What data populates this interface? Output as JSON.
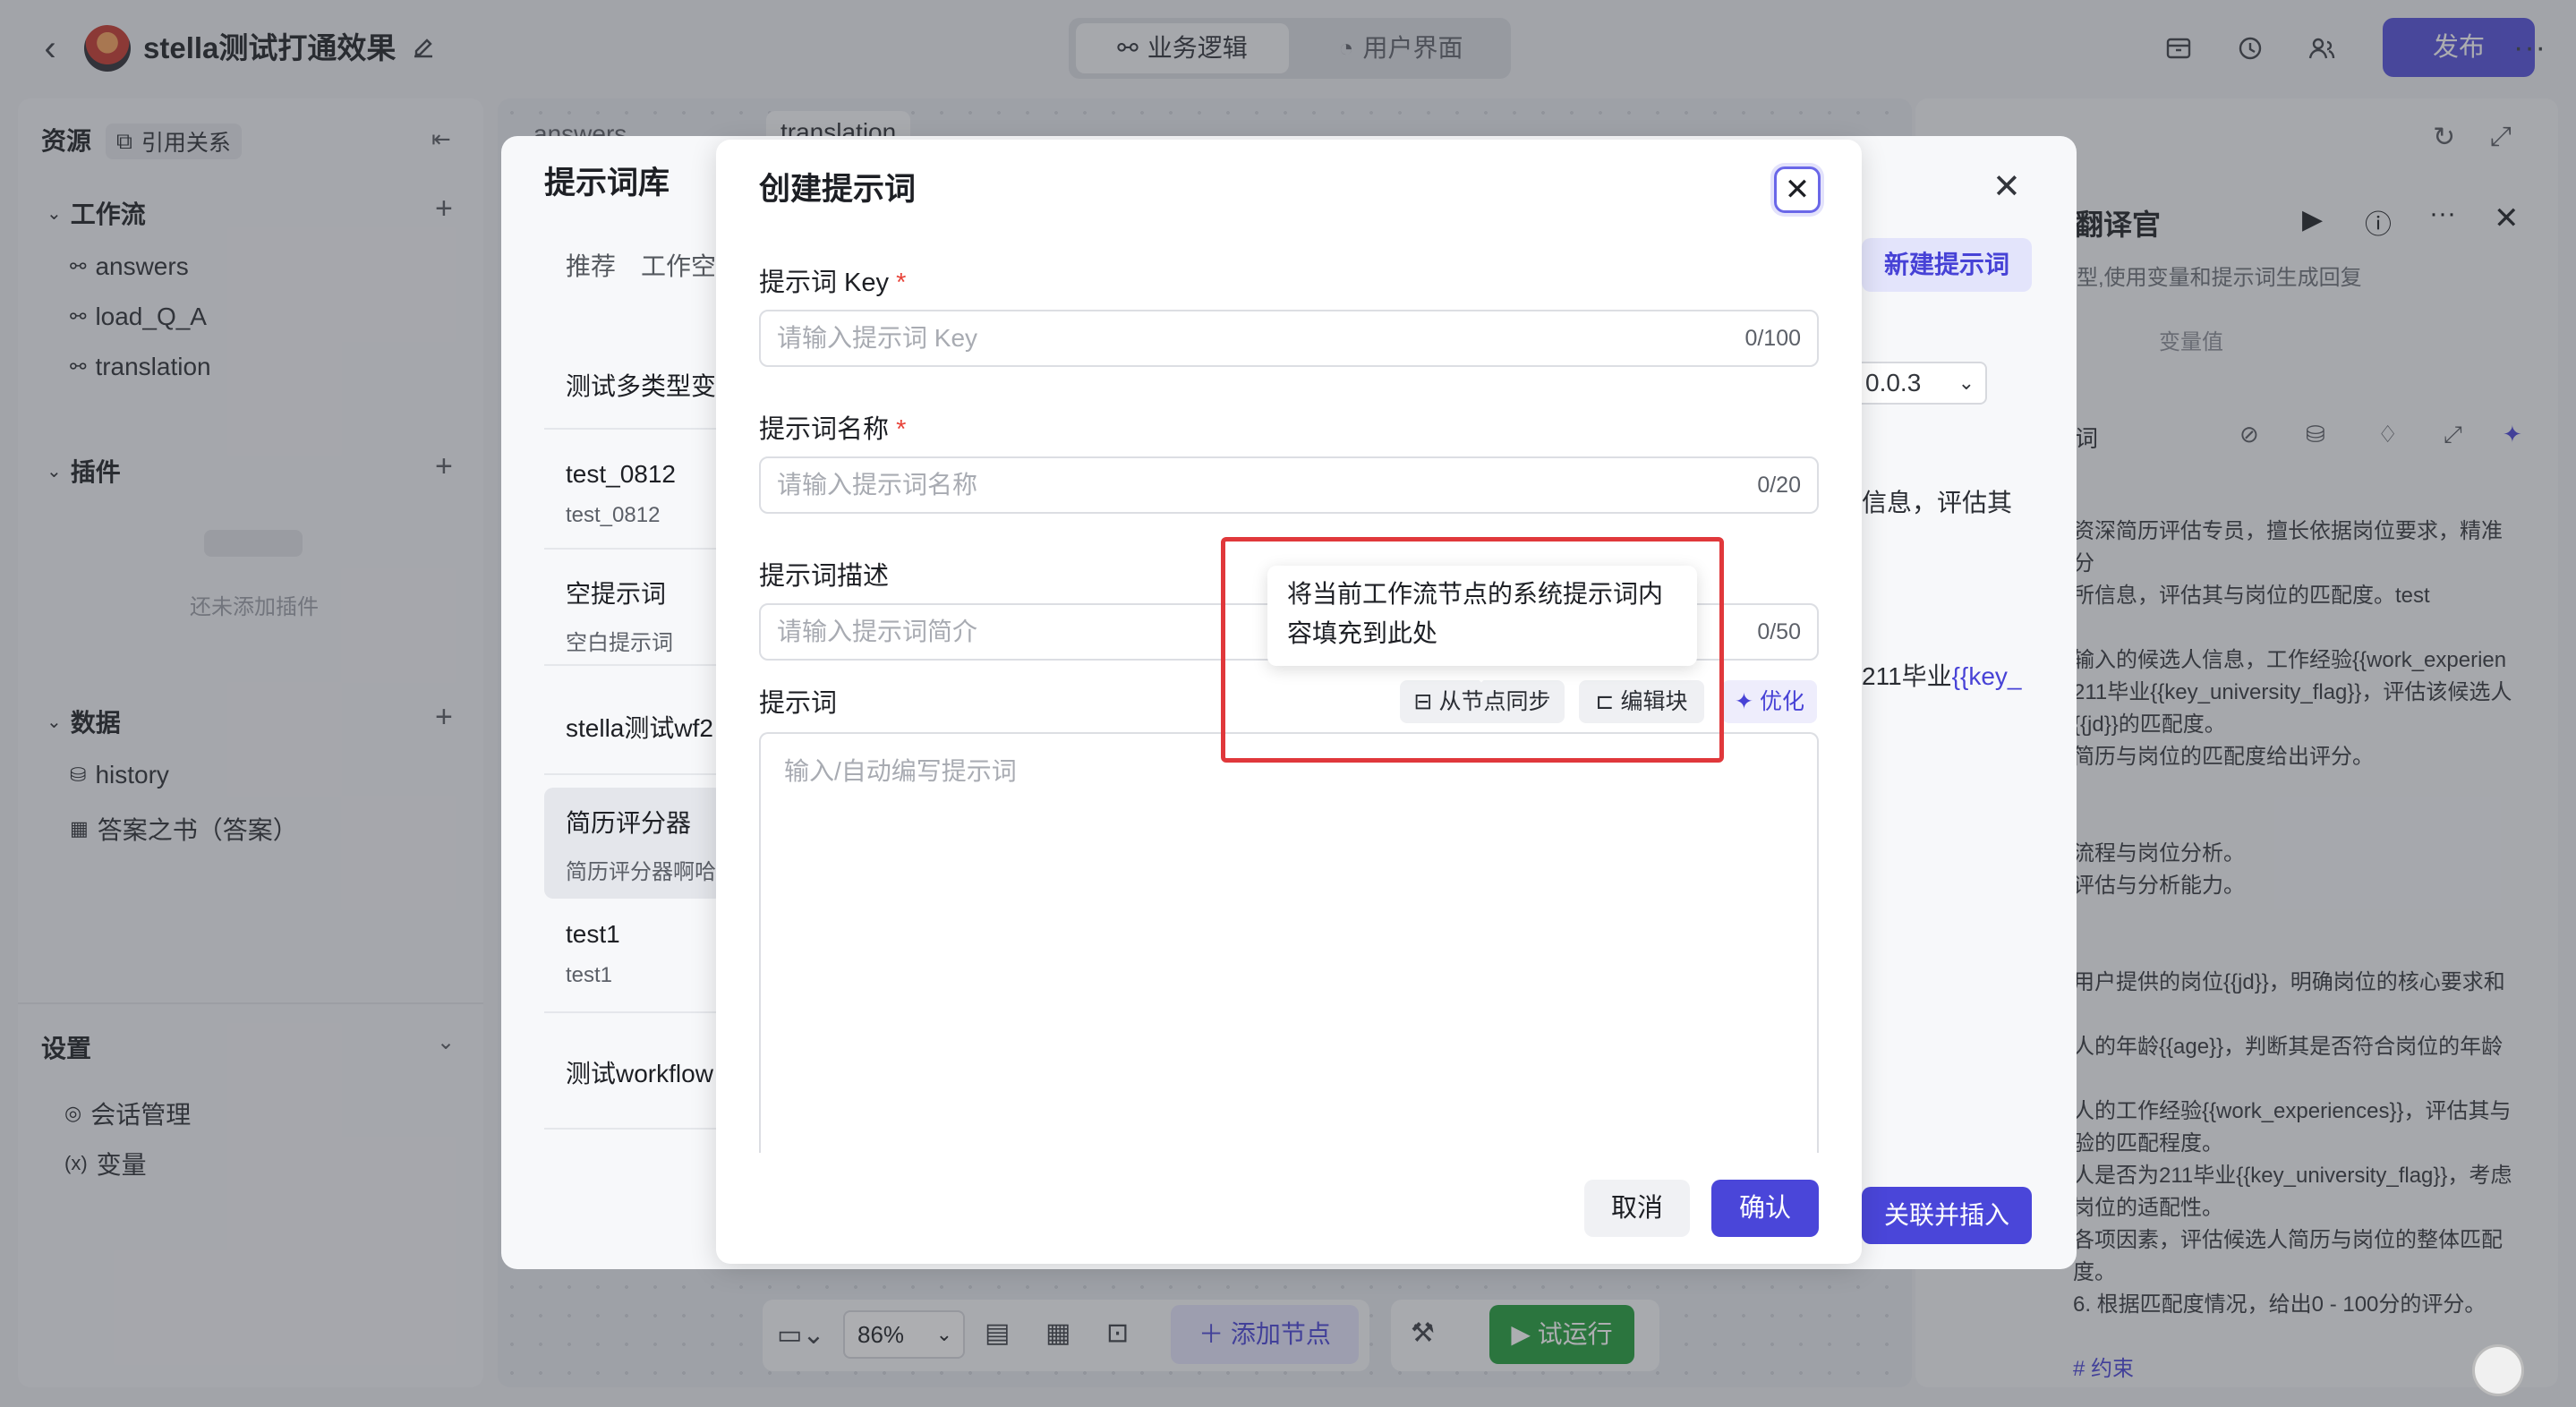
{
  "app": {
    "title": "stella测试打通效果",
    "tabs": [
      "业务逻辑",
      "用户界面"
    ],
    "publish": "发布"
  },
  "sidebar": {
    "resources": "资源",
    "references": "引用关系",
    "workflow_title": "工作流",
    "workflows": [
      "answers",
      "load_Q_A",
      "translation"
    ],
    "plugin_title": "插件",
    "plugin_empty": "还未添加插件",
    "data_title": "数据",
    "data_items": [
      "history",
      "答案之书（答案）"
    ],
    "settings_title": "设置",
    "settings_items": [
      "会话管理",
      "变量"
    ]
  },
  "canvas_tabs": [
    "answers",
    "translation"
  ],
  "library": {
    "title": "提示词库",
    "tabs": [
      "推荐",
      "工作空"
    ],
    "new_button": "新建提示词",
    "items": [
      {
        "name": "测试多类型变",
        "desc": ""
      },
      {
        "name": "test_0812",
        "desc": "test_0812"
      },
      {
        "name": "空提示词",
        "desc": "空白提示词"
      },
      {
        "name": "stella测试wf2",
        "desc": ""
      },
      {
        "name": "简历评分器",
        "desc": "简历评分器啊哈"
      },
      {
        "name": "test1",
        "desc": "test1"
      },
      {
        "name": "测试workflow",
        "desc": ""
      }
    ],
    "version": "0.0.3",
    "preview_line1": "信息，评估其",
    "preview_line2_prefix": "211毕业",
    "preview_line2_var": "{{key_",
    "assoc_button": "关联并插入"
  },
  "right_panel": {
    "title": "翻译官",
    "subtitle": "型,使用变量和提示词生成回复",
    "tab": "变量值",
    "label": "词",
    "lines": [
      "资深简历评估专员，擅长依据岗位要求，精准分",
      "所信息，评估其与岗位的匹配度。test",
      "",
      "输入的候选人信息，工作经验{{work_experien",
      "211毕业{{key_university_flag}}，评估该候选人",
      "{{jd}}的匹配度。",
      "简历与岗位的匹配度给出评分。",
      "",
      "",
      "流程与岗位分析。",
      "评估与分析能力。",
      "",
      "",
      "用户提供的岗位{{jd}}，明确岗位的核心要求和",
      "",
      "人的年龄{{age}}，判断其是否符合岗位的年龄",
      "",
      "人的工作经验{{work_experiences}}，评估其与",
      "验的匹配程度。",
      "人是否为211毕业{{key_university_flag}}，考虑",
      "岗位的适配性。",
      "各项因素，评估候选人简历与岗位的整体匹配",
      "度。",
      "6. 根据匹配度情况，给出0 - 100分的评分。",
      "",
      "# 约束"
    ]
  },
  "bottom": {
    "zoom": "86%",
    "add_node": "添加节点",
    "trial_run": "试运行"
  },
  "dialog": {
    "title": "创建提示词",
    "key_label": "提示词 Key",
    "key_placeholder": "请输入提示词 Key",
    "key_count": "0/100",
    "name_label": "提示词名称",
    "name_placeholder": "请输入提示词名称",
    "name_count": "0/20",
    "desc_label": "提示词描述",
    "desc_placeholder": "请输入提示词简介",
    "desc_count": "0/50",
    "prompt_label": "提示词",
    "prompt_placeholder": "输入/自动编写提示词",
    "sync_button": "从节点同步",
    "block_button": "编辑块",
    "optimize_button": "优化",
    "tooltip": "将当前工作流节点的系统提示词内容填充到此处",
    "cancel": "取消",
    "confirm": "确认",
    "required_mark": "*"
  },
  "colors": {
    "accent": "#4a46d9",
    "highlight_box": "#e0383b",
    "required": "#e8443a",
    "run": "#1f9d3a"
  }
}
